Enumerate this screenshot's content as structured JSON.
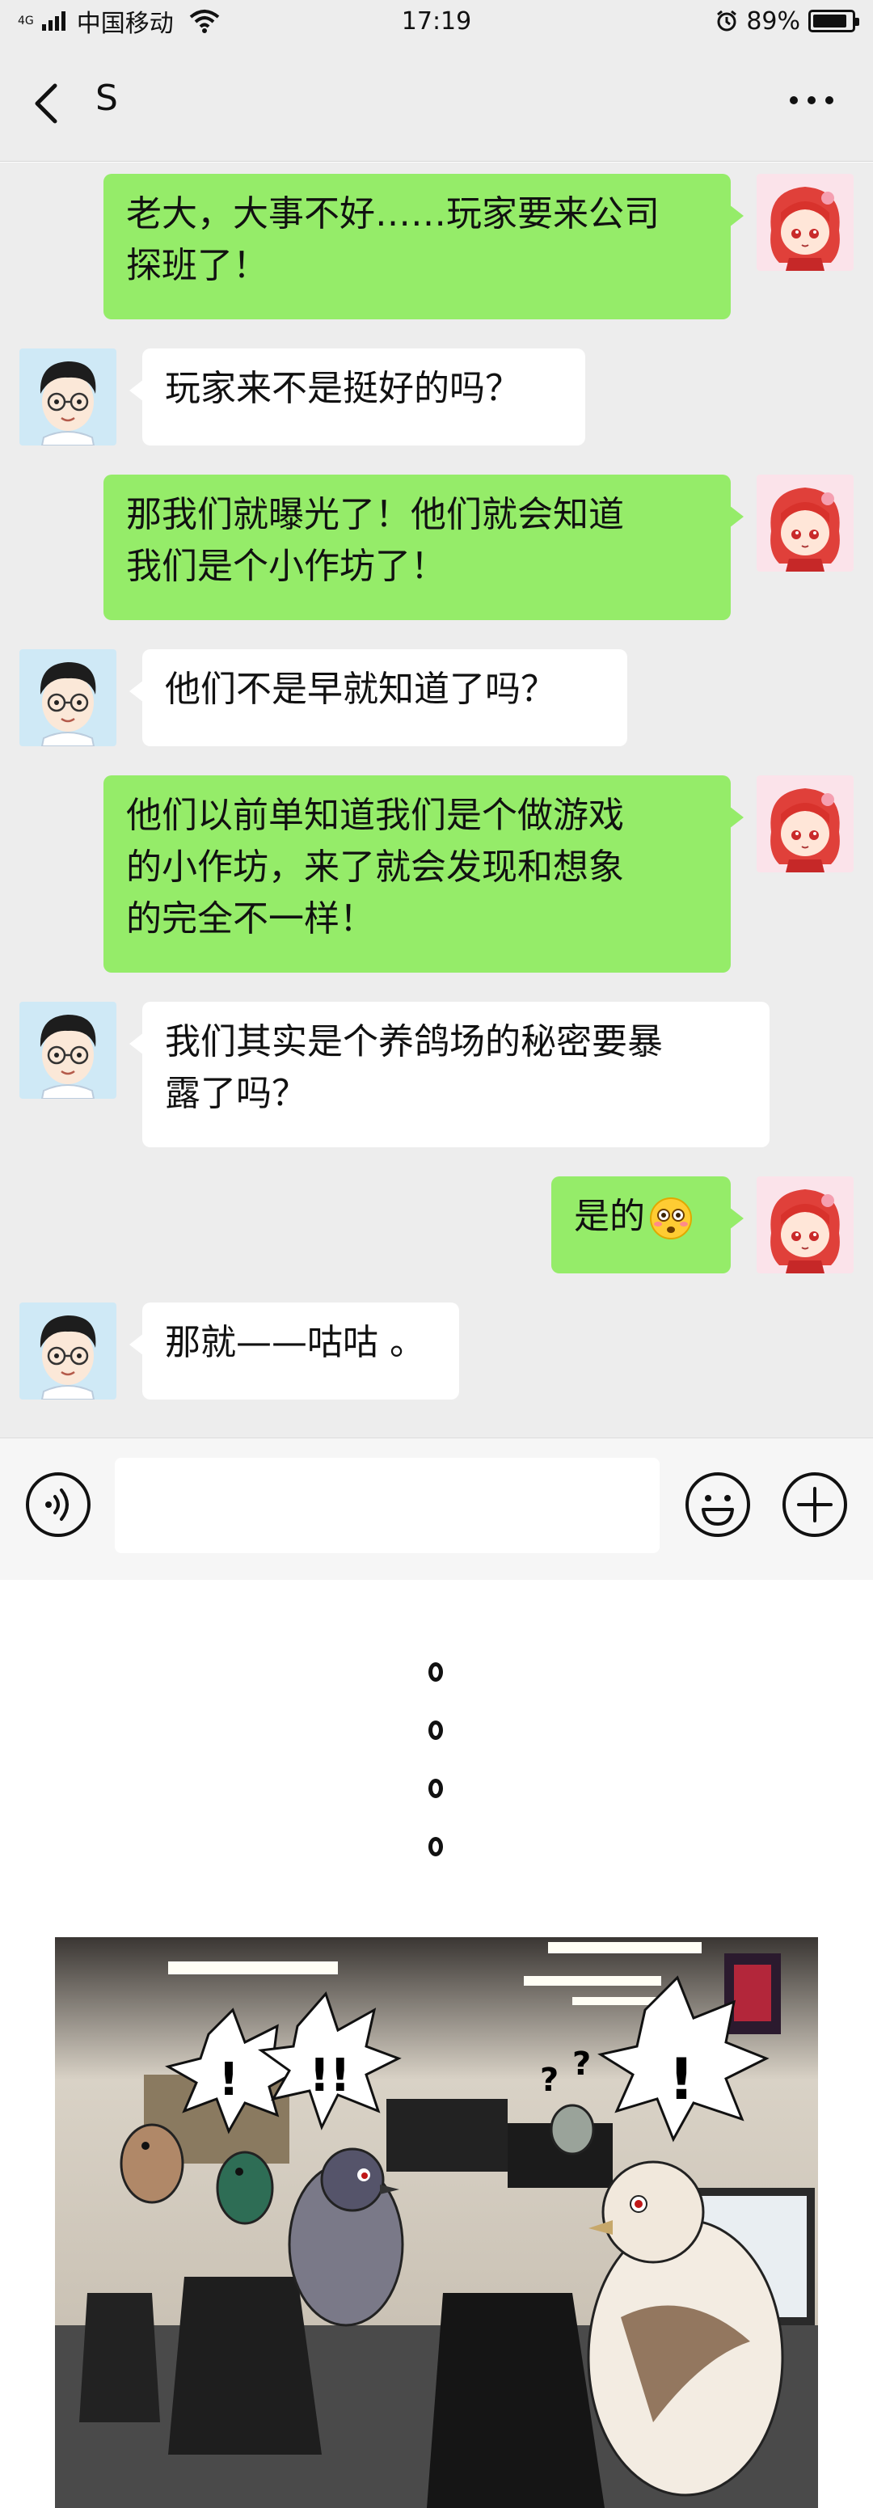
{
  "status_bar": {
    "network": "4G",
    "carrier": "中国移动",
    "time": "17:19",
    "battery_percent": "89%",
    "battery_level": 0.89
  },
  "header": {
    "back_icon": "chevron-left-icon",
    "title": "S",
    "more_icon": "more-horizontal-icon"
  },
  "messages": [
    {
      "from": "me",
      "lines": [
        "老大，大事不好……玩家要来公司",
        "探班了！"
      ]
    },
    {
      "from": "other",
      "lines": [
        "玩家来不是挺好的吗？"
      ]
    },
    {
      "from": "me",
      "lines": [
        "那我们就曝光了！他们就会知道",
        "我们是个小作坊了！"
      ]
    },
    {
      "from": "other",
      "lines": [
        "他们不是早就知道了吗？"
      ]
    },
    {
      "from": "me",
      "lines": [
        "他们以前单知道我们是个做游戏",
        "的小作坊，来了就会发现和想象",
        "的完全不一样！"
      ]
    },
    {
      "from": "other",
      "lines": [
        "我们其实是个养鸽场的秘密要暴",
        "露了吗？"
      ]
    },
    {
      "from": "me",
      "lines": [
        "是的"
      ],
      "emoji": "flushed-face-icon"
    },
    {
      "from": "other",
      "lines": [
        "那就——咕咕 。"
      ]
    }
  ],
  "input_bar": {
    "voice_icon": "voice-icon",
    "input_value": "",
    "emoji_icon": "smile-icon",
    "plus_icon": "plus-icon"
  },
  "colors": {
    "chat_bg": "#ededed",
    "my_bubble": "#95ec69",
    "other_bubble": "#ffffff"
  },
  "comic": {
    "photo_text": {
      "exclaim_1": "!",
      "exclaim_2": "!!",
      "question": "?",
      "exclaim_3": "!"
    }
  }
}
